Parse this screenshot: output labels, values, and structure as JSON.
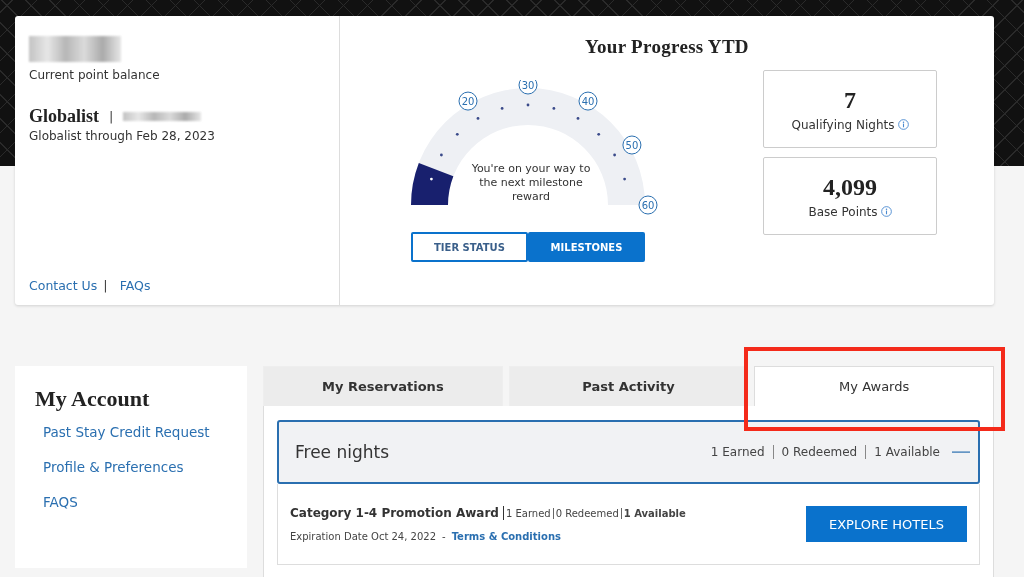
{
  "summary": {
    "balance_label": "Current point balance",
    "tier": "Globalist",
    "separator": "|",
    "tier_through": "Globalist through Feb 28, 2023",
    "links": [
      {
        "label": "Contact Us"
      },
      {
        "label": "FAQs"
      }
    ],
    "link_separator": "|"
  },
  "progress": {
    "title": "Your Progress YTD",
    "gauge": {
      "milestones": [
        "20",
        "30",
        "40",
        "50",
        "60"
      ],
      "message": "You're on your way to the next milestone reward"
    },
    "toggle": [
      {
        "label": "TIER STATUS",
        "selected": false
      },
      {
        "label": "MILESTONES",
        "selected": true
      }
    ],
    "stats": [
      {
        "value": "7",
        "label": "Qualifying Nights"
      },
      {
        "value": "4,099",
        "label": "Base Points"
      }
    ]
  },
  "account": {
    "title": "My Account",
    "links": [
      {
        "label": "Past Stay Credit Request"
      },
      {
        "label": "Profile & Preferences"
      },
      {
        "label": "FAQS"
      }
    ]
  },
  "tabs": [
    {
      "label": "My Reservations",
      "selected": false
    },
    {
      "label": "Past Activity",
      "selected": false
    },
    {
      "label": "My Awards",
      "selected": true
    }
  ],
  "awards": {
    "section": {
      "title": "Free nights",
      "counts": [
        "1 Earned",
        "0 Redeemed",
        "1 Available"
      ],
      "expanded": true
    },
    "items": [
      {
        "name": "Category 1-4 Promotion Award",
        "counts": [
          {
            "text": "1 Earned",
            "bold": false
          },
          {
            "text": "0 Redeemed",
            "bold": false
          },
          {
            "text": "1 Available",
            "bold": true
          }
        ],
        "expiration": "Expiration Date Oct 24, 2022",
        "dash": "-",
        "terms": "Terms & Conditions",
        "button": "EXPLORE HOTELS"
      }
    ]
  }
}
